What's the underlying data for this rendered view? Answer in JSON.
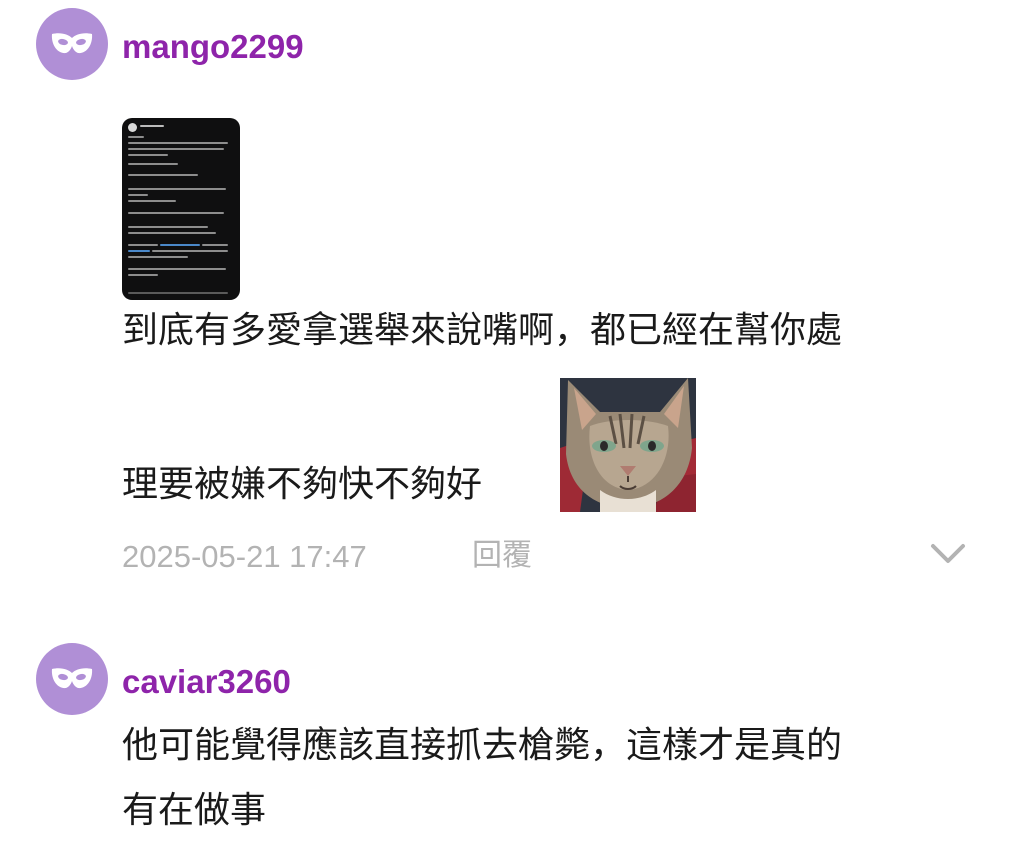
{
  "comments": [
    {
      "username": "mango2299",
      "lines": [
        "到底有多愛拿選舉來說嘴啊，都已經在幫你處",
        "理要被嫌不夠快不夠好"
      ],
      "timestamp": "2025-05-21 17:47",
      "reply_label": "回覆",
      "avatar_icon": "mask-icon",
      "attachment_icon": "screenshot-thumbnail",
      "sticker_icon": "cat-sticker"
    },
    {
      "username": "caviar3260",
      "lines": [
        "他可能覺得應該直接抓去槍斃，這樣才是真的",
        "有在做事"
      ],
      "avatar_icon": "mask-icon"
    }
  ],
  "colors": {
    "username": "#8e24aa",
    "avatar_bg": "#b08fd6",
    "meta_text": "#b3b3b3",
    "body_text": "#1a1a1a"
  }
}
